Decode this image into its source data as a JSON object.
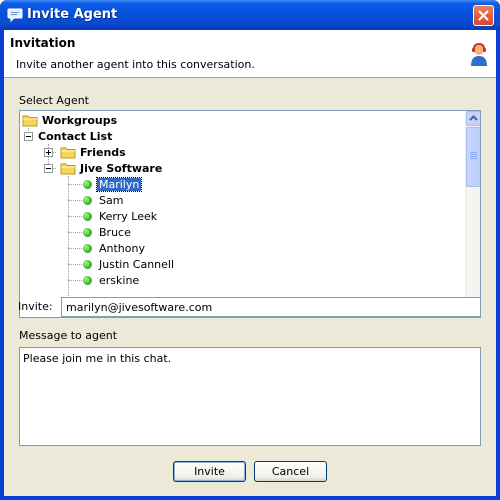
{
  "window": {
    "title": "Invite Agent",
    "icon": "chat-bubble-icon",
    "close_icon": "close-icon"
  },
  "header": {
    "title": "Invitation",
    "description": "Invite another agent into this conversation.",
    "icon": "agent-headset-icon"
  },
  "select_agent_label": "Select Agent",
  "tree": {
    "root": {
      "label": "Workgroups",
      "icon": "folder-icon"
    },
    "contact_list": {
      "label": "Contact List",
      "expanded": true
    },
    "groups": [
      {
        "label": "Friends",
        "expanded": false,
        "icon": "folder-icon"
      },
      {
        "label": "Jive Software",
        "expanded": true,
        "icon": "folder-icon"
      }
    ],
    "contacts": [
      {
        "name": "Marilyn",
        "status": "online",
        "selected": true
      },
      {
        "name": "Sam",
        "status": "online"
      },
      {
        "name": "Kerry Leek",
        "status": "online"
      },
      {
        "name": "Bruce",
        "status": "online"
      },
      {
        "name": "Anthony",
        "status": "online"
      },
      {
        "name": "Justin Cannell",
        "status": "online"
      },
      {
        "name": "erskine",
        "status": "online"
      }
    ],
    "status_color": "#3cb81e",
    "selection_color": "#316ac5"
  },
  "invite": {
    "label": "Invite:",
    "value": "marilyn@jivesoftware.com"
  },
  "message": {
    "label": "Message to agent",
    "value": "Please join me in this chat."
  },
  "buttons": {
    "invite": "Invite",
    "cancel": "Cancel"
  },
  "colors": {
    "titlebar": "#0651dc",
    "dialog_bg": "#ece9d8"
  }
}
